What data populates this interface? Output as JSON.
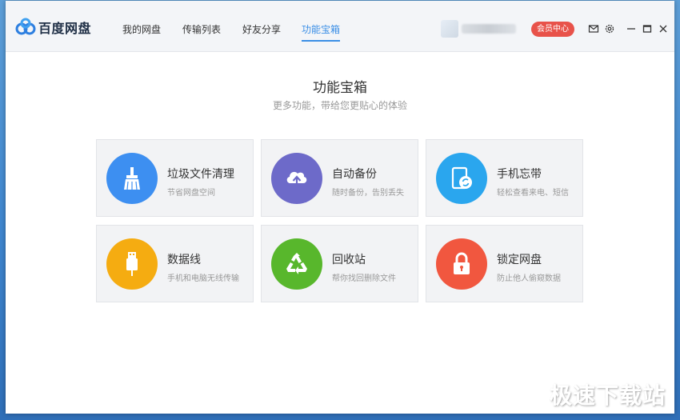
{
  "app": {
    "name": "百度网盘"
  },
  "nav": {
    "tabs": [
      {
        "label": "我的网盘",
        "active": false
      },
      {
        "label": "传输列表",
        "active": false
      },
      {
        "label": "好友分享",
        "active": false
      },
      {
        "label": "功能宝箱",
        "active": true
      }
    ]
  },
  "header": {
    "vip_label": "会员中心"
  },
  "page": {
    "title": "功能宝箱",
    "subtitle": "更多功能，带给您更贴心的体验"
  },
  "features": [
    {
      "title": "垃圾文件清理",
      "desc": "节省网盘空间",
      "color": "#3d8ff1",
      "icon": "broom-icon"
    },
    {
      "title": "自动备份",
      "desc": "随时备份，告别丢失",
      "color": "#6d6ac9",
      "icon": "cloud-upload-icon"
    },
    {
      "title": "手机忘带",
      "desc": "轻松查看来电、短信",
      "color": "#2aa6ee",
      "icon": "phone-sync-icon"
    },
    {
      "title": "数据线",
      "desc": "手机和电脑无线传输",
      "color": "#f5ac11",
      "icon": "usb-icon"
    },
    {
      "title": "回收站",
      "desc": "帮你找回删除文件",
      "color": "#58b72c",
      "icon": "recycle-icon"
    },
    {
      "title": "锁定网盘",
      "desc": "防止他人偷窥数据",
      "color": "#f1573f",
      "icon": "lock-icon"
    }
  ],
  "colors": {
    "accent": "#3b8fe6",
    "vip": "#e8524a"
  },
  "watermark": "极速下载站"
}
